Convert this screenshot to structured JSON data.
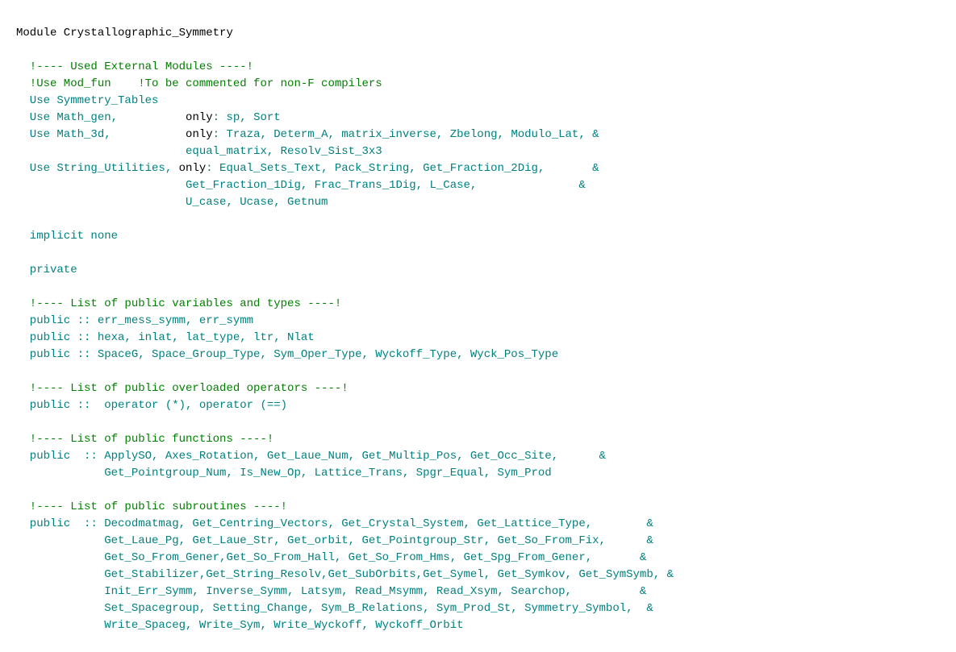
{
  "title": "Module Crystallographic_Symmetry",
  "lines": [
    {
      "text": "Module Crystallographic_Symmetry",
      "color": "black"
    },
    {
      "text": "",
      "color": "black"
    },
    {
      "text": "  !---- Used External Modules ----!",
      "color": "green"
    },
    {
      "text": "  !Use Mod_fun    !To be commented for non-F compilers",
      "color": "green"
    },
    {
      "text": "  Use Symmetry_Tables",
      "color": "teal"
    },
    {
      "text": "  Use Math_gen,          only: sp, Sort",
      "color": "teal",
      "only": true
    },
    {
      "text": "  Use Math_3d,           only: Traza, Determ_A, matrix_inverse, Zbelong, Modulo_Lat, &",
      "color": "teal",
      "only": true
    },
    {
      "text": "                         equal_matrix, Resolv_Sist_3x3",
      "color": "teal"
    },
    {
      "text": "  Use String_Utilities, only: Equal_Sets_Text, Pack_String, Get_Fraction_2Dig,       &",
      "color": "teal",
      "only": true
    },
    {
      "text": "                         Get_Fraction_1Dig, Frac_Trans_1Dig, L_Case,               &",
      "color": "teal"
    },
    {
      "text": "                         U_case, Ucase, Getnum",
      "color": "teal"
    },
    {
      "text": "",
      "color": "black"
    },
    {
      "text": "  implicit none",
      "color": "teal"
    },
    {
      "text": "",
      "color": "black"
    },
    {
      "text": "  private",
      "color": "teal"
    },
    {
      "text": "",
      "color": "black"
    },
    {
      "text": "  !---- List of public variables and types ----!",
      "color": "green"
    },
    {
      "text": "  public :: err_mess_symm, err_symm",
      "color": "teal"
    },
    {
      "text": "  public :: hexa, inlat, lat_type, ltr, Nlat",
      "color": "teal"
    },
    {
      "text": "  public :: SpaceG, Space_Group_Type, Sym_Oper_Type, Wyckoff_Type, Wyck_Pos_Type",
      "color": "teal"
    },
    {
      "text": "",
      "color": "black"
    },
    {
      "text": "  !---- List of public overloaded operators ----!",
      "color": "green"
    },
    {
      "text": "  public ::  operator (*), operator (==)",
      "color": "teal"
    },
    {
      "text": "",
      "color": "black"
    },
    {
      "text": "  !---- List of public functions ----!",
      "color": "green"
    },
    {
      "text": "  public  :: ApplySO, Axes_Rotation, Get_Laue_Num, Get_Multip_Pos, Get_Occ_Site,      &",
      "color": "teal"
    },
    {
      "text": "             Get_Pointgroup_Num, Is_New_Op, Lattice_Trans, Spgr_Equal, Sym_Prod",
      "color": "teal"
    },
    {
      "text": "",
      "color": "black"
    },
    {
      "text": "  !---- List of public subroutines ----!",
      "color": "green"
    },
    {
      "text": "  public  :: Decodmatmag, Get_Centring_Vectors, Get_Crystal_System, Get_Lattice_Type,        &",
      "color": "teal"
    },
    {
      "text": "             Get_Laue_Pg, Get_Laue_Str, Get_orbit, Get_Pointgroup_Str, Get_So_From_Fix,      &",
      "color": "teal"
    },
    {
      "text": "             Get_So_From_Gener,Get_So_From_Hall, Get_So_From_Hms, Get_Spg_From_Gener,       &",
      "color": "teal"
    },
    {
      "text": "             Get_Stabilizer,Get_String_Resolv,Get_SubOrbits,Get_Symel, Get_Symkov, Get_SymSymb, &",
      "color": "teal"
    },
    {
      "text": "             Init_Err_Symm, Inverse_Symm, Latsym, Read_Msymm, Read_Xsym, Searchop,          &",
      "color": "teal"
    },
    {
      "text": "             Set_Spacegroup, Setting_Change, Sym_B_Relations, Sym_Prod_St, Symmetry_Symbol,  &",
      "color": "teal"
    },
    {
      "text": "             Write_Spaceg, Write_Sym, Write_Wyckoff, Wyckoff_Orbit",
      "color": "teal"
    }
  ]
}
